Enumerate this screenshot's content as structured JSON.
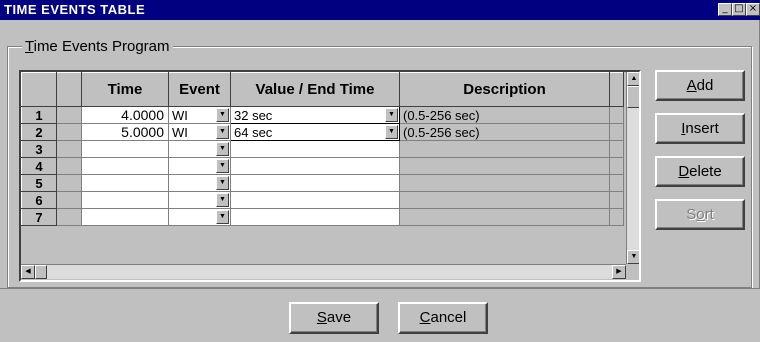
{
  "window": {
    "title": "Time Events Table",
    "controls": [
      "minimize-icon",
      "maximize-icon",
      "close-icon"
    ]
  },
  "group": {
    "label_first": "T",
    "label_rest": "ime Events Program"
  },
  "grid": {
    "columns": [
      "Time",
      "Event",
      "Value / End Time",
      "Description"
    ],
    "rows": [
      {
        "num": "1",
        "time": "4.0000",
        "event": "WI",
        "value": "32 sec",
        "description": "(0.5-256 sec)"
      },
      {
        "num": "2",
        "time": "5.0000",
        "event": "WI",
        "value": "64 sec",
        "description": "(0.5-256 sec)"
      },
      {
        "num": "3",
        "time": "",
        "event": "",
        "value": "",
        "description": ""
      },
      {
        "num": "4",
        "time": "",
        "event": "",
        "value": "",
        "description": ""
      },
      {
        "num": "5",
        "time": "",
        "event": "",
        "value": "",
        "description": ""
      },
      {
        "num": "6",
        "time": "",
        "event": "",
        "value": "",
        "description": ""
      },
      {
        "num": "7",
        "time": "",
        "event": "",
        "value": "",
        "description": ""
      }
    ]
  },
  "side_buttons": {
    "add": {
      "mn": "A",
      "rest": "dd"
    },
    "insert": {
      "mn": "I",
      "rest": "nsert"
    },
    "delete": {
      "mn": "D",
      "rest": "elete"
    },
    "sort": {
      "pre": "S",
      "mn": "o",
      "rest": "rt",
      "enabled": false
    }
  },
  "footer_buttons": {
    "save": {
      "mn": "S",
      "rest": "ave"
    },
    "cancel": {
      "mn": "C",
      "rest": "ancel"
    }
  },
  "colors": {
    "titlebar": "#000080",
    "face": "#c0c0c0"
  }
}
